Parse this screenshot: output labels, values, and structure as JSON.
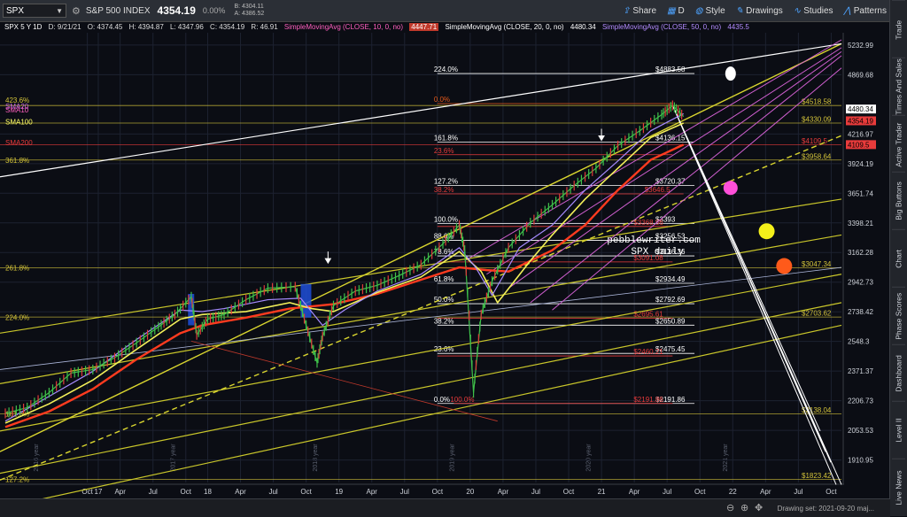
{
  "toolbar": {
    "symbol": "SPX",
    "name": "S&P 500 INDEX",
    "last": "4354.19",
    "change": "0.00%",
    "bid": "B: 4304.11",
    "ask": "A: 4386.52",
    "share": "Share",
    "period": "D",
    "style": "Style",
    "drawings": "Drawings",
    "studies": "Studies",
    "patterns": "Patterns"
  },
  "infobar": {
    "title": "SPX 5 Y 1D",
    "date": "D: 9/21/21",
    "open": "O: 4374.45",
    "high": "H: 4394.87",
    "low": "L: 4347.96",
    "close": "C: 4354.19",
    "r": "R: 46.91",
    "sma10": "SimpleMovingAvg (CLOSE, 10, 0, no)",
    "sma10_val": "4447.71",
    "sma20": "SimpleMovingAvg (CLOSE, 20, 0, no)",
    "sma20_val": "4480.34",
    "sma50": "SimpleMovingAvg (CLOSE, 50, 0, no)",
    "sma50_val": "4435.5"
  },
  "sidebar": [
    "Trade",
    "Times And Sales",
    "Active Trader",
    "Big Buttons",
    "Chart",
    "Phase Scores",
    "Dashboard",
    "Level II",
    "Live News"
  ],
  "bottom": {
    "drawing_set": "Drawing set: 2021-09-20 maj..."
  },
  "watermark": {
    "line1": "pebblewriter.com",
    "line2": "SPX daily"
  },
  "chart_data": {
    "type": "line",
    "title": "SPX 5 Y 1D",
    "ylim": [
      1790,
      5300
    ],
    "y_ticks": [
      "5232.99",
      "4869.68",
      "4216.97",
      "3924.19",
      "3651.74",
      "3398.21",
      "3162.28",
      "2942.73",
      "2738.42",
      "2548.3",
      "2371.37",
      "2206.73",
      "2053.53",
      "1910.95"
    ],
    "x_ticks": [
      {
        "label": "Oct",
        "pos": 7.5
      },
      {
        "label": "17",
        "pos": 8.5
      },
      {
        "label": "Apr",
        "pos": 10.5
      },
      {
        "label": "Jul",
        "pos": 13.5
      },
      {
        "label": "Oct",
        "pos": 16.5
      },
      {
        "label": "18",
        "pos": 18.5
      },
      {
        "label": "Apr",
        "pos": 21.5
      },
      {
        "label": "Jul",
        "pos": 24.5
      },
      {
        "label": "Oct",
        "pos": 27.5
      },
      {
        "label": "19",
        "pos": 30.5
      },
      {
        "label": "Apr",
        "pos": 33.5
      },
      {
        "label": "Jul",
        "pos": 36.5
      },
      {
        "label": "Oct",
        "pos": 39.5
      },
      {
        "label": "20",
        "pos": 42.5
      },
      {
        "label": "Apr",
        "pos": 45.5
      },
      {
        "label": "Jul",
        "pos": 48.5
      },
      {
        "label": "Oct",
        "pos": 51.5
      },
      {
        "label": "21",
        "pos": 54.5
      },
      {
        "label": "Apr",
        "pos": 57.5
      },
      {
        "label": "Jul",
        "pos": 60.5
      },
      {
        "label": "Oct",
        "pos": 63.5
      },
      {
        "label": "22",
        "pos": 66.5
      },
      {
        "label": "Apr",
        "pos": 69.5
      },
      {
        "label": "Jul",
        "pos": 72.5
      },
      {
        "label": "Oct",
        "pos": 75.5
      }
    ],
    "year_labels": [
      {
        "label": "2016 year",
        "pos": 3
      },
      {
        "label": "2017 year",
        "pos": 15.5
      },
      {
        "label": "2018 year",
        "pos": 28.5
      },
      {
        "label": "2019 year",
        "pos": 41
      },
      {
        "label": "2020 year",
        "pos": 53.5
      },
      {
        "label": "2021 year",
        "pos": 66
      }
    ],
    "price_tags": [
      {
        "label": "4480.34",
        "value": 4480.34,
        "color": "#ffffff",
        "text": "#000000"
      },
      {
        "label": "4354.19",
        "value": 4354.19,
        "color": "#e83b3b",
        "text": "#000000"
      },
      {
        "label": "4109.5",
        "value": 4109.5,
        "color": "#e83b3b",
        "text": "#000000"
      }
    ],
    "left_labels": [
      {
        "text": "423.6%",
        "value": 4580,
        "color": "#d4c43a"
      },
      {
        "text": "SMA20",
        "value": 4510,
        "color": "#c46be0"
      },
      {
        "text": "SMA10",
        "value": 4470,
        "color": "#ff5fbf"
      },
      {
        "text": "SMA100",
        "value": 4345,
        "color": "#ffff66"
      },
      {
        "text": "SMA200",
        "value": 4130,
        "color": "#e83b3b"
      },
      {
        "text": "361.8%",
        "value": 3958,
        "color": "#d4c43a"
      },
      {
        "text": "261.8%",
        "value": 3047,
        "color": "#d4c43a"
      },
      {
        "text": "224.0%",
        "value": 2703,
        "color": "#d4c43a"
      },
      {
        "text": "161.8%",
        "value": 2138,
        "color": "#d4c43a"
      },
      {
        "text": "127.2%",
        "value": 1823,
        "color": "#d4c43a"
      }
    ],
    "fib_levels": [
      {
        "pct": "224.0%",
        "value": 4883.58,
        "label": "$4883.58",
        "x1": 39.5,
        "x2": 63,
        "color": "#ffffff",
        "pcolor": "#ffffff"
      },
      {
        "pct": "0.0%",
        "value": 4540,
        "label": "",
        "x1": 39.5,
        "x2": 61,
        "color": "#e85a1a",
        "pcolor": "#e85a1a"
      },
      {
        "pct": "161.8%",
        "value": 4136.15,
        "label": "$4136.15",
        "x1": 39.5,
        "x2": 63,
        "color": "#ffffff",
        "pcolor": "#ffffff"
      },
      {
        "pct": "23.6%",
        "value": 4010,
        "label": "",
        "x1": 39.5,
        "x2": 61,
        "color": "#e83b3b",
        "pcolor": "#e83b3b"
      },
      {
        "pct": "127.2%",
        "value": 3720.37,
        "label": "$3720.37",
        "x1": 39.5,
        "x2": 63,
        "color": "#ffffff",
        "pcolor": "#ffffff"
      },
      {
        "pct": "38.2%",
        "value": 3646.5,
        "label": "$3646.5",
        "x1": 39.5,
        "x2": 62,
        "color": "#e83b3b",
        "pcolor": "#e83b3b"
      },
      {
        "pct": "100.0%",
        "value": 3393,
        "label": "$3393",
        "x1": 39.5,
        "x2": 63,
        "color": "#ffffff",
        "pcolor": "#ffffff"
      },
      {
        "pct": "",
        "value": 3368.86,
        "label": "$3368.86",
        "x1": 39.5,
        "x2": 61,
        "color": "#e83b3b",
        "pcolor": "#e83b3b"
      },
      {
        "pct": "88.6%",
        "value": 3256.53,
        "label": "$3256.53",
        "x1": 39.5,
        "x2": 63,
        "color": "#ffffff",
        "pcolor": "#ffffff"
      },
      {
        "pct": "78.6%",
        "value": 3136.36,
        "label": "$3136.36",
        "x1": 39.5,
        "x2": 63,
        "color": "#ffffff",
        "pcolor": "#ffffff"
      },
      {
        "pct": "",
        "value": 3091.08,
        "label": "$3091.08",
        "x1": 39.5,
        "x2": 61,
        "color": "#e83b3b",
        "pcolor": "#e83b3b"
      },
      {
        "pct": "61.8%",
        "value": 2934.49,
        "label": "$2934.49",
        "x1": 39.5,
        "x2": 63,
        "color": "#ffffff",
        "pcolor": "#ffffff"
      },
      {
        "pct": "50.0%",
        "value": 2792.69,
        "label": "$2792.69",
        "x1": 39.5,
        "x2": 63,
        "color": "#ffffff",
        "pcolor": "#ffffff"
      },
      {
        "pct": "",
        "value": 2695.61,
        "label": "$2695.61",
        "x1": 39.5,
        "x2": 61,
        "color": "#e83b3b",
        "pcolor": "#e83b3b"
      },
      {
        "pct": "38.2%",
        "value": 2650.89,
        "label": "$2650.89",
        "x1": 39.5,
        "x2": 63,
        "color": "#ffffff",
        "pcolor": "#ffffff"
      },
      {
        "pct": "23.6%",
        "value": 2475.45,
        "label": "$2475.45",
        "x1": 39.5,
        "x2": 63,
        "color": "#ffffff",
        "pcolor": "#ffffff"
      },
      {
        "pct": "",
        "value": 2460.21,
        "label": "$2460.21",
        "x1": 39.5,
        "x2": 61,
        "color": "#e83b3b",
        "pcolor": "#e83b3b"
      },
      {
        "pct": "0.0%",
        "value": 2191.86,
        "label": "$2191.86",
        "x1": 39.5,
        "x2": 63,
        "color": "#ffffff",
        "pcolor": "#ffffff"
      },
      {
        "pct": "100.0%",
        "value": 2191.86,
        "label": "$2191.86",
        "x1": 41,
        "x2": 61,
        "color": "#e83b3b",
        "pcolor": "#e83b3b"
      }
    ],
    "right_levels": [
      {
        "label": "$4518.58",
        "value": 4518.58,
        "color": "#d4c43a"
      },
      {
        "label": "$4330.09",
        "value": 4330.09,
        "color": "#d4c43a"
      },
      {
        "label": "$4109.5",
        "value": 4109.5,
        "color": "#e83b3b"
      },
      {
        "label": "$3958.64",
        "value": 3958.64,
        "color": "#d4c43a"
      },
      {
        "label": "$3047.34",
        "value": 3047.34,
        "color": "#d4c43a"
      },
      {
        "label": "$2703.62",
        "value": 2703.62,
        "color": "#d4c43a"
      },
      {
        "label": "$2138.04",
        "value": 2138.04,
        "color": "#d4c43a"
      },
      {
        "label": "$1823.42",
        "value": 1823.42,
        "color": "#d4c43a"
      }
    ],
    "price": {
      "name": "SPX",
      "x": [
        0,
        2,
        4,
        6,
        8,
        10,
        12,
        14,
        15.5,
        17,
        17.5,
        18.5,
        20,
        22,
        24,
        26.5,
        27.5,
        28.5,
        29,
        30,
        32,
        34,
        36,
        38,
        40,
        41.5,
        42,
        42.8,
        43.5,
        44.5,
        46,
        48,
        50,
        52,
        54,
        56,
        58,
        60,
        61,
        62
      ],
      "y": [
        2140,
        2170,
        2250,
        2360,
        2380,
        2450,
        2540,
        2640,
        2720,
        2840,
        2590,
        2690,
        2720,
        2820,
        2900,
        2910,
        2650,
        2420,
        2580,
        2780,
        2880,
        2920,
        2990,
        3070,
        3230,
        3380,
        3180,
        2250,
        2720,
        2950,
        3200,
        3400,
        3550,
        3720,
        3880,
        4100,
        4250,
        4420,
        4520,
        4400
      ]
    },
    "sma50": {
      "name": "SMA50",
      "x": [
        0,
        4,
        8,
        12,
        16,
        18,
        20,
        24,
        27,
        29,
        31,
        34,
        38,
        41.5,
        43,
        44.5,
        47,
        50,
        53,
        56,
        59,
        62
      ],
      "y": [
        2100,
        2230,
        2370,
        2560,
        2750,
        2740,
        2760,
        2820,
        2830,
        2650,
        2750,
        2880,
        3000,
        3200,
        3050,
        2850,
        3200,
        3380,
        3680,
        3950,
        4250,
        4430
      ]
    },
    "sma200": {
      "name": "SMA200",
      "x": [
        0,
        4,
        8,
        12,
        16,
        18,
        22,
        26,
        30,
        34,
        38,
        41.5,
        44,
        46,
        50,
        53,
        56,
        59,
        62
      ],
      "y": [
        2070,
        2150,
        2270,
        2440,
        2600,
        2650,
        2700,
        2760,
        2790,
        2860,
        2960,
        3050,
        3030,
        3020,
        3180,
        3380,
        3680,
        3960,
        4109.5
      ]
    },
    "sma100": {
      "name": "SMA100",
      "x": [
        0,
        4,
        8,
        12,
        16,
        18,
        22,
        26,
        28,
        30,
        34,
        38,
        41.5,
        43.5,
        45,
        48,
        50,
        53,
        56,
        59,
        62
      ],
      "y": [
        2090,
        2190,
        2320,
        2500,
        2690,
        2720,
        2740,
        2800,
        2760,
        2740,
        2870,
        2980,
        3170,
        3020,
        2800,
        3100,
        3300,
        3600,
        3880,
        4180,
        4330
      ]
    }
  }
}
